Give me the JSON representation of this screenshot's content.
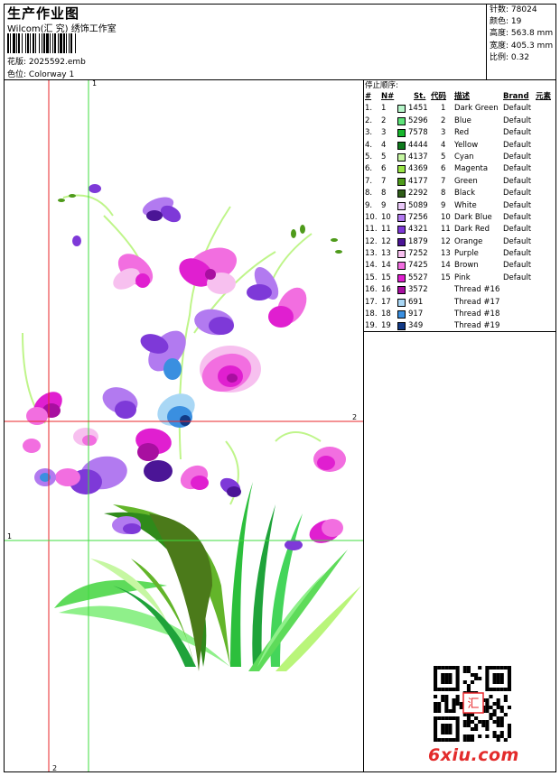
{
  "header": {
    "title": "生产作业图",
    "company": "Wilcom(汇 究) 绣饰工作室",
    "design_file_label": "花版:",
    "design_file": "2025592.emb",
    "colorway_label": "色位:",
    "colorway": "Colorway 1"
  },
  "stats": {
    "stitches_label": "针数:",
    "stitches": "78024",
    "colors_label": "颜色:",
    "colors": "19",
    "height_label": "高度:",
    "height": "563.8 mm",
    "width_label": "宽度:",
    "width": "405.3 mm",
    "scale_label": "比例:",
    "scale": "0.32"
  },
  "guides": {
    "top_marker": "1",
    "right_marker": "2",
    "left_marker": "1",
    "bottom_marker": "2"
  },
  "color_table": {
    "title": "停止顺序:",
    "headers": {
      "index": "#",
      "needle": "N#",
      "stitches": "St.",
      "code": "代码",
      "description": "描述",
      "brand": "Brand",
      "element": "元素"
    },
    "rows": [
      {
        "index": "1.",
        "needle": "1",
        "color": "#b6f5c9",
        "stitches": "1451",
        "code": "1",
        "description": "Dark Green",
        "brand": "Default"
      },
      {
        "index": "2.",
        "needle": "2",
        "color": "#5ee37a",
        "stitches": "5296",
        "code": "2",
        "description": "Blue",
        "brand": "Default"
      },
      {
        "index": "3.",
        "needle": "3",
        "color": "#17b62c",
        "stitches": "7578",
        "code": "3",
        "description": "Red",
        "brand": "Default"
      },
      {
        "index": "4.",
        "needle": "4",
        "color": "#0e7a1d",
        "stitches": "4444",
        "code": "4",
        "description": "Yellow",
        "brand": "Default"
      },
      {
        "index": "5.",
        "needle": "5",
        "color": "#c6f7a2",
        "stitches": "4137",
        "code": "5",
        "description": "Cyan",
        "brand": "Default"
      },
      {
        "index": "6.",
        "needle": "6",
        "color": "#9ae646",
        "stitches": "4369",
        "code": "6",
        "description": "Magenta",
        "brand": "Default"
      },
      {
        "index": "7.",
        "needle": "7",
        "color": "#4e9a1a",
        "stitches": "4177",
        "code": "7",
        "description": "Green",
        "brand": "Default"
      },
      {
        "index": "8.",
        "needle": "8",
        "color": "#2f5d18",
        "stitches": "2292",
        "code": "8",
        "description": "Black",
        "brand": "Default"
      },
      {
        "index": "9.",
        "needle": "9",
        "color": "#e9c8f8",
        "stitches": "5089",
        "code": "9",
        "description": "White",
        "brand": "Default"
      },
      {
        "index": "10.",
        "needle": "10",
        "color": "#b27af0",
        "stitches": "7256",
        "code": "10",
        "description": "Dark Blue",
        "brand": "Default"
      },
      {
        "index": "11.",
        "needle": "11",
        "color": "#7e39d8",
        "stitches": "4321",
        "code": "11",
        "description": "Dark Red",
        "brand": "Default"
      },
      {
        "index": "12.",
        "needle": "12",
        "color": "#4b1596",
        "stitches": "1879",
        "code": "12",
        "description": "Orange",
        "brand": "Default"
      },
      {
        "index": "13.",
        "needle": "13",
        "color": "#f7c0ef",
        "stitches": "7252",
        "code": "13",
        "description": "Purple",
        "brand": "Default"
      },
      {
        "index": "14.",
        "needle": "14",
        "color": "#f26ee0",
        "stitches": "7425",
        "code": "14",
        "description": "Brown",
        "brand": "Default"
      },
      {
        "index": "15.",
        "needle": "15",
        "color": "#e01fd0",
        "stitches": "5527",
        "code": "15",
        "description": "Pink",
        "brand": "Default"
      },
      {
        "index": "16.",
        "needle": "16",
        "color": "#a80fa0",
        "stitches": "3572",
        "code": "",
        "description": "Thread #16",
        "brand": ""
      },
      {
        "index": "17.",
        "needle": "17",
        "color": "#a9d7f5",
        "stitches": "691",
        "code": "",
        "description": "Thread #17",
        "brand": ""
      },
      {
        "index": "18.",
        "needle": "18",
        "color": "#3a8fe0",
        "stitches": "917",
        "code": "",
        "description": "Thread #18",
        "brand": ""
      },
      {
        "index": "19.",
        "needle": "19",
        "color": "#123a86",
        "stitches": "349",
        "code": "",
        "description": "Thread #19",
        "brand": ""
      }
    ]
  },
  "watermark": "6xiu.com",
  "qr_center_text": "汇",
  "colors": {
    "guide_red": "#e8262a",
    "guide_green": "#3fdc3f"
  }
}
